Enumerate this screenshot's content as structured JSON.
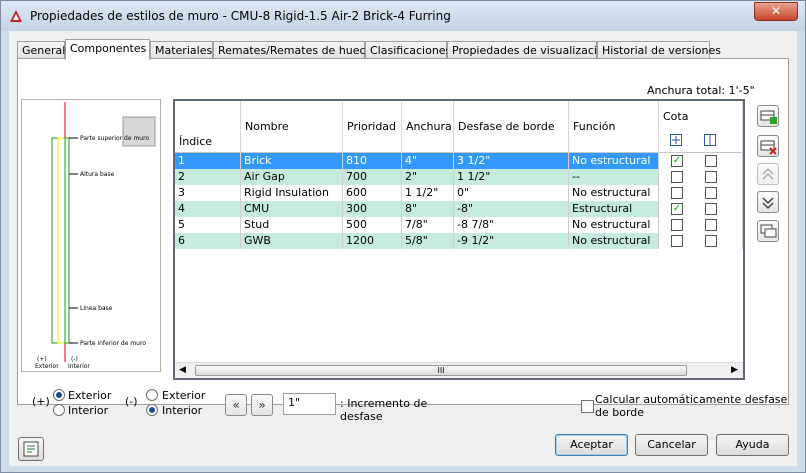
{
  "window": {
    "title": "Propiedades de estilos de muro - CMU-8 Rigid-1.5 Air-2 Brick-4 Furring",
    "close_label": "✕"
  },
  "tabs": [
    {
      "label": "General"
    },
    {
      "label": "Componentes"
    },
    {
      "label": "Materiales"
    },
    {
      "label": "Remates/Remates de huecos"
    },
    {
      "label": "Clasificaciones"
    },
    {
      "label": "Propiedades de visualización"
    },
    {
      "label": "Historial de versiones"
    }
  ],
  "anchura_total": "Anchura total: 1'-5\"",
  "preview": {
    "labels": [
      "Parte superior de muro",
      "Altura base",
      "Línea base",
      "Parte inferior de muro"
    ],
    "exterior": "(+)\nExterior",
    "interior": "(-)\nInterior",
    "ext_sign": "(+)",
    "ext_word": "Exterior",
    "int_sign": "(-)",
    "int_word": "Interior"
  },
  "table": {
    "headers": {
      "indice": "Índice",
      "nombre": "Nombre",
      "prioridad": "Prioridad",
      "anchura": "Anchura",
      "desfase": "Desfase de borde",
      "funcion": "Función",
      "cota": "Cota"
    },
    "rows": [
      {
        "indice": "1",
        "nombre": "Brick",
        "prioridad": "810",
        "anchura": "4\"",
        "desfase": "3 1/2\"",
        "funcion": "No estructural",
        "cota1": true,
        "cota2": false
      },
      {
        "indice": "2",
        "nombre": "Air Gap",
        "prioridad": "700",
        "anchura": "2\"",
        "desfase": "1 1/2\"",
        "funcion": "--",
        "cota1": false,
        "cota2": false
      },
      {
        "indice": "3",
        "nombre": "Rigid Insulation",
        "prioridad": "600",
        "anchura": "1 1/2\"",
        "desfase": "0\"",
        "funcion": "No estructural",
        "cota1": false,
        "cota2": false
      },
      {
        "indice": "4",
        "nombre": "CMU",
        "prioridad": "300",
        "anchura": "8\"",
        "desfase": "-8\"",
        "funcion": "Estructural",
        "cota1": true,
        "cota2": false
      },
      {
        "indice": "5",
        "nombre": "Stud",
        "prioridad": "500",
        "anchura": "7/8\"",
        "desfase": "-8 7/8\"",
        "funcion": "No estructural",
        "cota1": false,
        "cota2": false
      },
      {
        "indice": "6",
        "nombre": "GWB",
        "prioridad": "1200",
        "anchura": "5/8\"",
        "desfase": "-9 1/2\"",
        "funcion": "No estructural",
        "cota1": false,
        "cota2": false
      }
    ],
    "scroll_thumb": "III"
  },
  "bottom": {
    "plus_label": "(+)",
    "minus_label": "(-)",
    "exterior": "Exterior",
    "interior": "Interior",
    "increment_value": "1\"",
    "increment_label_1": ": Incremento de",
    "increment_label_2": "desfase",
    "auto_calc_1": "Calcular automáticamente desfase",
    "auto_calc_2": "de borde"
  },
  "buttons": {
    "accept": "Aceptar",
    "cancel": "Cancelar",
    "help": "Ayuda"
  },
  "colors": {
    "selected_row": "#3399ff",
    "alt_row": "#c5ecdc",
    "accent": "#1a4a9c"
  }
}
